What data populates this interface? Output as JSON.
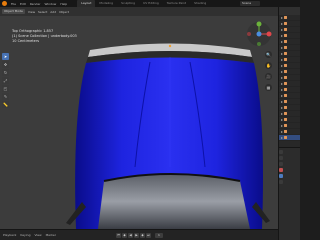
{
  "menus": [
    "File",
    "Edit",
    "Render",
    "Window",
    "Help"
  ],
  "tabs": [
    "Layout",
    "Modeling",
    "Sculpting",
    "UV Editing",
    "Texture Paint",
    "Shading"
  ],
  "active_tab_index": 0,
  "scene_name": "Scene",
  "viewport_header": {
    "mode": "Object Mode",
    "view": "View",
    "select": "Select",
    "add": "Add",
    "object": "Object"
  },
  "overlay_lines": [
    "Top Orthographic 1.857",
    "(1) Scene Collection | underbody.003",
    "10 Centimeters"
  ],
  "colors": {
    "car_body": "#1a1fd6",
    "viewport_bg": "#3c3c3c",
    "accent_blue": "#4772b3",
    "axis_x": "#e0464b",
    "axis_y": "#6cb33b",
    "axis_z": "#4a8ee0"
  },
  "timeline": {
    "playback": "Playback",
    "keying": "Keying",
    "view": "View",
    "marker": "Marker",
    "current_frame": "1"
  },
  "icons": {
    "tools": [
      "cursor-icon",
      "move-icon",
      "rotate-icon",
      "scale-icon",
      "transform-icon",
      "annotate-icon",
      "measure-icon"
    ],
    "gizmo": [
      "zoom-icon",
      "hand-icon",
      "camera-icon",
      "grid-icon"
    ]
  }
}
